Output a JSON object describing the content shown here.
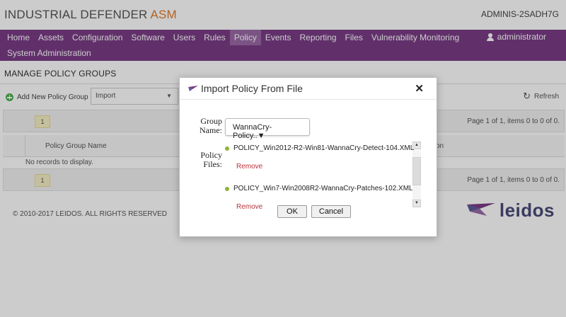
{
  "header": {
    "brand_main": "INDUSTRIAL DEFENDER",
    "brand_accent": "ASM",
    "hostname": "ADMINIS-2SADH7G"
  },
  "nav": {
    "items": [
      "Home",
      "Assets",
      "Configuration",
      "Software",
      "Users",
      "Rules",
      "Policy",
      "Events",
      "Reporting",
      "Files",
      "Vulnerability Monitoring"
    ],
    "row2": [
      "System Administration"
    ],
    "active": "Policy",
    "user": "administrator"
  },
  "page": {
    "title": "MANAGE POLICY GROUPS",
    "add_label": "Add New Policy Group",
    "import_select": "Import",
    "refresh_label": "Refresh",
    "page_number": "1",
    "pager_info": "Page 1 of 1, items 0 to 0 of 0.",
    "col_name": "Policy Group Name",
    "col_desc_partial": "on",
    "no_records": "No records to display."
  },
  "footer": {
    "copyright": "© 2010-2017 LEIDOS. ALL RIGHTS RESERVED",
    "logo": "leidos"
  },
  "modal": {
    "title": "Import Policy From File",
    "group_label_line1": "Group",
    "group_label_line2": "Name:",
    "group_value": "WannaCry-Policy..",
    "files_label_line1": "Policy",
    "files_label_line2": "Files:",
    "files": [
      {
        "name": "POLICY_Win2012-R2-Win81-WannaCry-Detect-104.XML",
        "remove": "Remove"
      },
      {
        "name": "POLICY_Win7-Win2008R2-WannaCry-Patches-102.XML",
        "remove": "Remove"
      }
    ],
    "ok_label": "OK",
    "cancel_label": "Cancel"
  },
  "colors": {
    "nav_bg": "#7a3d86",
    "brand_accent": "#e07b2a",
    "remove_link": "#b8323a",
    "file_dot": "#8db33a"
  }
}
